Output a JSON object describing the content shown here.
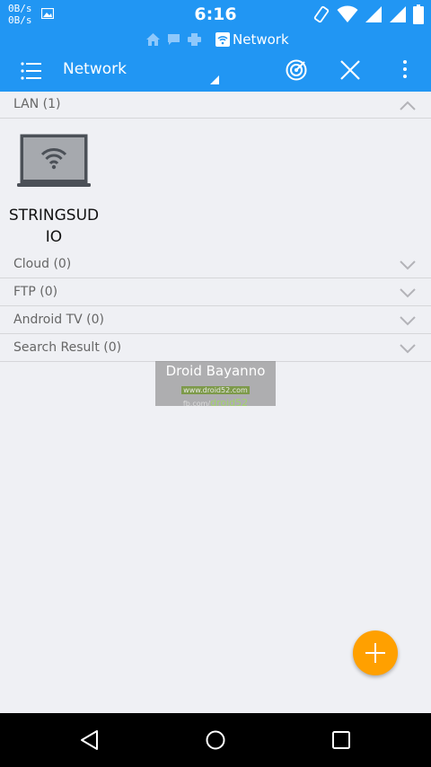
{
  "status_bar": {
    "up_speed": "0B/s",
    "down_speed": "0B/s",
    "time": "6:16",
    "icons": [
      "image-icon",
      "rotate-icon",
      "wifi-icon",
      "signal-icon",
      "signal-icon",
      "battery-icon"
    ]
  },
  "breadcrumb": {
    "icons": [
      "home-icon",
      "chat-icon",
      "printer-icon",
      "wifi-icon"
    ],
    "current": "Network"
  },
  "toolbar": {
    "title": "Network",
    "actions": [
      "menu-icon",
      "scan-icon",
      "close-icon",
      "more-vert-icon"
    ]
  },
  "sections": [
    {
      "label": "LAN (1)",
      "expanded": true
    },
    {
      "label": "Cloud (0)",
      "expanded": false
    },
    {
      "label": "FTP (0)",
      "expanded": false
    },
    {
      "label": "Android TV (0)",
      "expanded": false
    },
    {
      "label": "Search Result (0)",
      "expanded": false
    }
  ],
  "lan_devices": [
    {
      "name": "STRINGSUDIO",
      "icon": "laptop-wifi-icon"
    }
  ],
  "watermark": {
    "title": "Droid Bayanno",
    "site": "www.droid52.com",
    "fb_prefix": "fb.com/",
    "fb_handle": "droid52"
  },
  "fab": {
    "icon": "plus-icon"
  },
  "nav_bar": {
    "icons": [
      "back-icon",
      "home-icon",
      "recent-apps-icon"
    ]
  },
  "colors": {
    "accent": "#2196f3",
    "fab": "#ffa000",
    "background": "#eff0f4"
  }
}
